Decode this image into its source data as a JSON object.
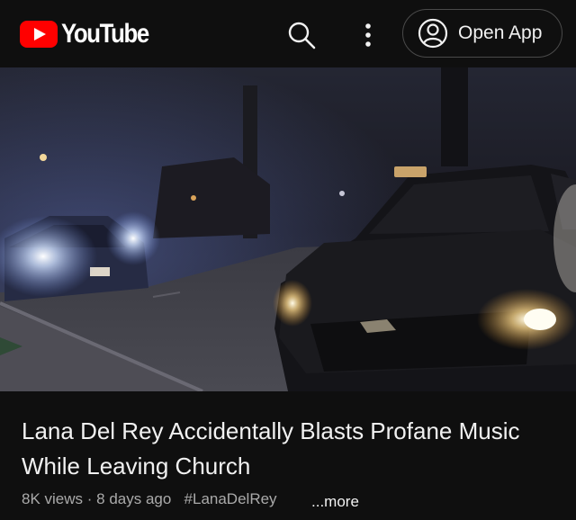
{
  "header": {
    "logo_text": "YouTube",
    "search_icon": "search-icon",
    "more_icon": "more-vertical-icon",
    "open_app_label": "Open App",
    "account_icon": "account-circle-icon",
    "brand_color": "#ff0000"
  },
  "video": {
    "title": "Lana Del Rey Accidentally Blasts Profane Music While Leaving Church",
    "views": "8K views",
    "separator": "·",
    "age": "8 days ago",
    "hashtag": "#LanaDelRey",
    "more_label": "...more"
  }
}
